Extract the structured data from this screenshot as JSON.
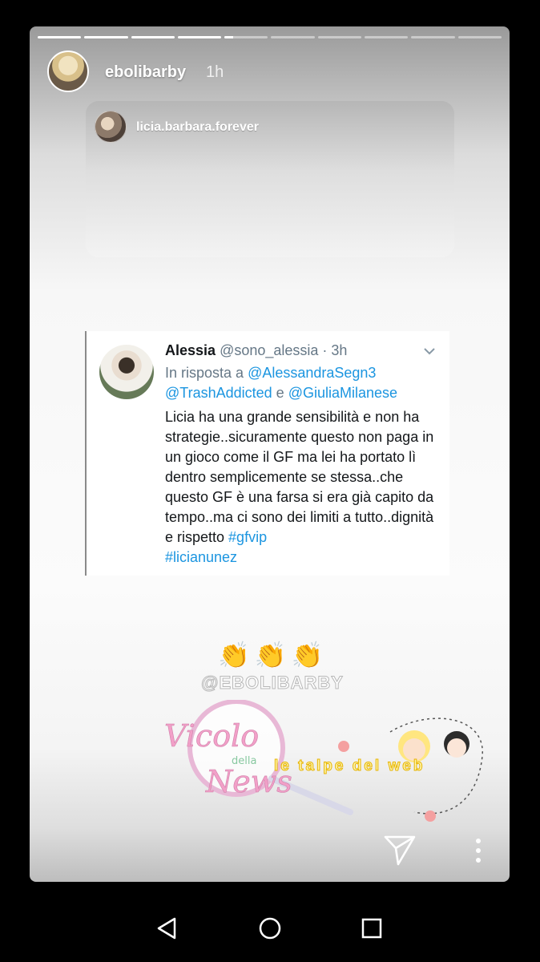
{
  "story": {
    "progress_segments": 10,
    "progress_current_index": 4,
    "progress_current_fraction": 0.2,
    "username": "ebolibarby",
    "time": "1h"
  },
  "repost": {
    "username": "licia.barbara.forever"
  },
  "tweet": {
    "name": "Alessia",
    "handle": "@sono_alessia",
    "separator": " · ",
    "time": "3h",
    "reply_prefix": "In risposta a ",
    "reply_mention_1": "@AlessandraSegn3",
    "reply_mention_2": "@TrashAddicted",
    "reply_conj": " e ",
    "reply_mention_3": "@GiuliaMilanese",
    "body": "Licia ha una grande sensibilità e non ha strategie..sicuramente questo non paga in un gioco come il GF ma lei ha portato lì dentro semplicemente se stessa..che questo GF è una farsa si era già capito da tempo..ma ci sono dei limiti a tutto..dignità e rispetto ",
    "hashtag_1": "#gfvip",
    "hashtag_2": "#licianunez"
  },
  "overlay": {
    "claps": "👏👏👏",
    "handle_watermark": "@EBOLIBARBY",
    "vicolo_line1": "Vicolo",
    "vicolo_line2": "della",
    "vicolo_line3": "News",
    "talpe_text": "le talpe del web"
  },
  "icons": {
    "send": "send-icon",
    "more": "more-vertical-icon",
    "chevron": "chevron-down-icon",
    "back": "back-triangle-icon",
    "home": "home-circle-icon",
    "recents": "recents-square-icon"
  }
}
